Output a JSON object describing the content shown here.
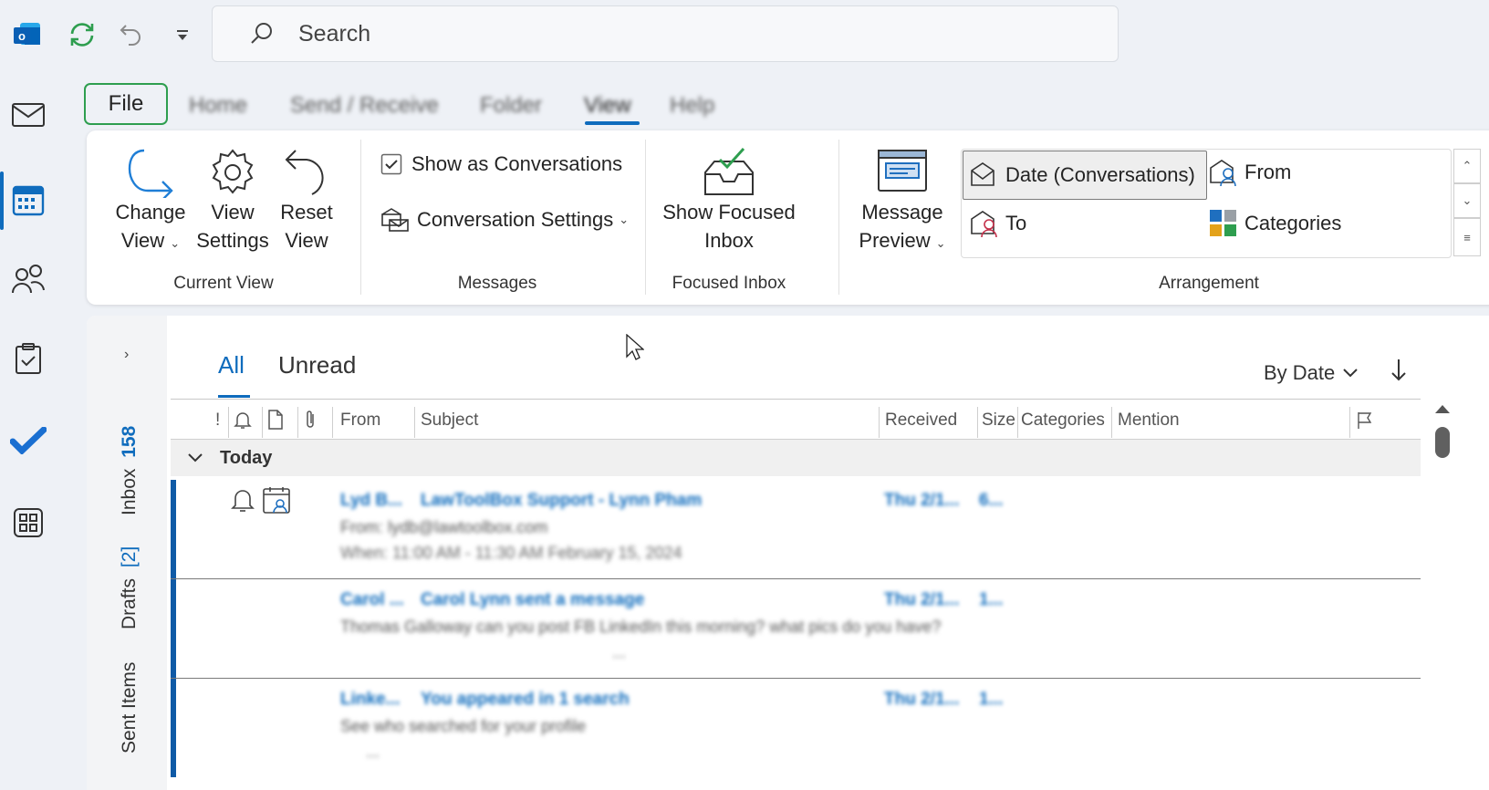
{
  "topbar": {
    "search_placeholder": "Search"
  },
  "ribbon_tabs": [
    {
      "label": "File"
    },
    {
      "label": "Home"
    },
    {
      "label": "Send / Receive"
    },
    {
      "label": "Folder"
    },
    {
      "label": "View"
    },
    {
      "label": "Help"
    }
  ],
  "ribbon": {
    "current_view": {
      "change_view": [
        "Change",
        "View"
      ],
      "view_settings": [
        "View",
        "Settings"
      ],
      "reset_view": [
        "Reset",
        "View"
      ],
      "label": "Current View"
    },
    "messages": {
      "show_as_conversations": "Show as Conversations",
      "conversation_settings": "Conversation Settings",
      "label": "Messages"
    },
    "focused_inbox": {
      "show_focused_inbox": [
        "Show Focused",
        "Inbox"
      ],
      "label": "Focused Inbox"
    },
    "arrangement": {
      "message_preview": [
        "Message",
        "Preview"
      ],
      "items": {
        "date": "Date (Conversations)",
        "from": "From",
        "to": "To",
        "categories": "Categories"
      },
      "label": "Arrangement"
    }
  },
  "folders": {
    "inbox": "Inbox",
    "inbox_count": "158",
    "drafts": "Drafts",
    "drafts_count": "[2]",
    "sent": "Sent Items"
  },
  "list": {
    "tab_all": "All",
    "tab_unread": "Unread",
    "sort": "By Date",
    "columns": {
      "importance": "!",
      "from": "From",
      "subject": "Subject",
      "received": "Received",
      "size": "Size",
      "categories": "Categories",
      "mention": "Mention"
    },
    "group_today": "Today",
    "messages": [
      {
        "from": "Lyd B...",
        "subject": "LawToolBox Support - Lynn Pham",
        "preview": "From: lydb@lawtoolbox.com",
        "preview2": "When: 11:00 AM - 11:30 AM February 15, 2024",
        "received": "Thu 2/1...",
        "size": "6..."
      },
      {
        "from": "Carol ...",
        "subject": "Carol Lynn sent a message",
        "preview": "Thomas Galloway can you post FB LinkedIn this morning?  what pics do you have?",
        "preview2": "...",
        "received": "Thu 2/1...",
        "size": "1..."
      },
      {
        "from": "Linke...",
        "subject": "You appeared in 1 search",
        "preview": "See who searched for your profile",
        "preview2": "...",
        "received": "Thu 2/1...",
        "size": "1..."
      }
    ]
  },
  "colors": {
    "accent": "#0f6cbd",
    "file_outline": "#2e9e4f",
    "unread_bar": "#0f5aa6"
  }
}
